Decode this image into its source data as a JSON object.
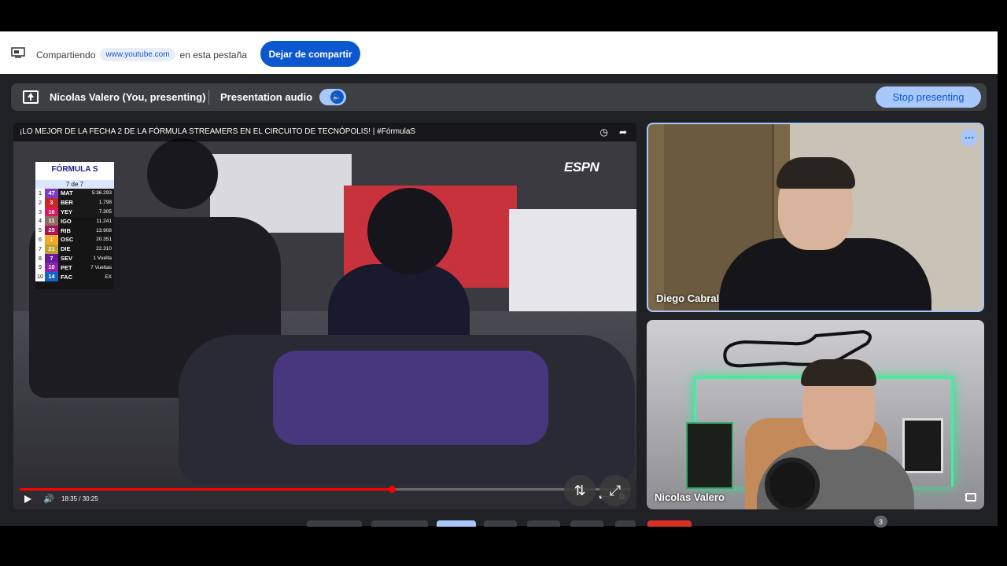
{
  "share_bar": {
    "prefix": "Compartiendo",
    "url": "www.youtube.com",
    "suffix": "en esta pestaña",
    "stop_button": "Dejar de compartir"
  },
  "present_bar": {
    "presenter": "Nicolas Valero (You, presenting)",
    "audio_label": "Presentation audio",
    "audio_on": true,
    "stop_button": "Stop presenting"
  },
  "video": {
    "title": "¡LO MEJOR DE LA FECHA 2 DE LA FÓRMULA STREAMERS EN EL CIRCUITO DE TECNÓPOLIS! | #FórmulaS",
    "channel_logo": "ESPN",
    "time": "18:35 / 30:25",
    "progress": 0.61
  },
  "standings": {
    "series": "FÓRMULA S",
    "round": "7 de 7",
    "rows": [
      {
        "pos": "1",
        "num": "47",
        "code": "MAT",
        "gap": "5:36.293",
        "color": "#7b3fc4"
      },
      {
        "pos": "2",
        "num": "3",
        "code": "BER",
        "gap": "1.798",
        "color": "#c62828"
      },
      {
        "pos": "3",
        "num": "16",
        "code": "YEY",
        "gap": "7.305",
        "color": "#d81b60"
      },
      {
        "pos": "4",
        "num": "11",
        "code": "IGO",
        "gap": "11.241",
        "color": "#8d6e63"
      },
      {
        "pos": "5",
        "num": "25",
        "code": "RIB",
        "gap": "13.908",
        "color": "#ad1457"
      },
      {
        "pos": "6",
        "num": "1",
        "code": "OSC",
        "gap": "20.351",
        "color": "#f9a825"
      },
      {
        "pos": "7",
        "num": "21",
        "code": "DIE",
        "gap": "22.310",
        "color": "#c0a030"
      },
      {
        "pos": "8",
        "num": "7",
        "code": "SEV",
        "gap": "1 Vuelta",
        "color": "#6a1b9a"
      },
      {
        "pos": "9",
        "num": "10",
        "code": "PET",
        "gap": "7 Vueltas",
        "color": "#8e24aa"
      },
      {
        "pos": "10",
        "num": "14",
        "code": "FAC",
        "gap": "EX",
        "color": "#1565c0"
      }
    ]
  },
  "participants": {
    "diego": "Diego Cabral",
    "nicolas": "Nicolas Valero"
  },
  "more_count": "3",
  "colors": {
    "accent": "#0b57d0",
    "accent_light": "#a8c7fa",
    "meet_bg": "#202124",
    "bar_bg": "#3c4043"
  }
}
